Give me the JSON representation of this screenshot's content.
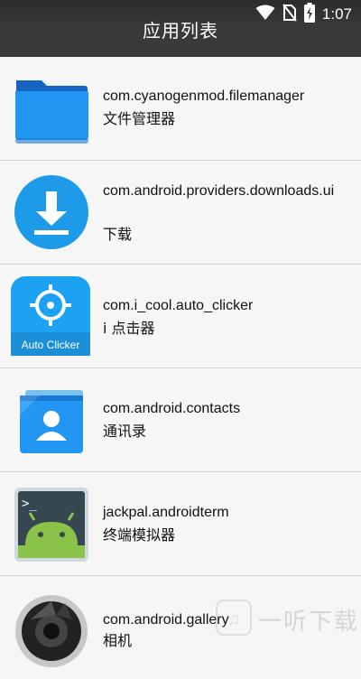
{
  "status_bar": {
    "time": "1:07",
    "icons": [
      "wifi-icon",
      "no-sim-icon",
      "battery-charging-icon"
    ]
  },
  "header": {
    "title": "应用列表"
  },
  "apps": [
    {
      "package": "com.cyanogenmod.filemanager",
      "label": "文件管理器",
      "icon": "folder-icon"
    },
    {
      "package": "com.android.providers.downloads.ui",
      "label": "下载",
      "icon": "download-icon"
    },
    {
      "package": "com.i_cool.auto_clicker",
      "label": "i 点击器",
      "icon": "auto-clicker-icon",
      "icon_text": "Auto Clicker"
    },
    {
      "package": "com.android.contacts",
      "label": "通讯录",
      "icon": "contacts-icon"
    },
    {
      "package": "jackpal.androidterm",
      "label": "终端模拟器",
      "icon": "terminal-icon",
      "icon_text": ">_"
    },
    {
      "package": "com.android.gallery",
      "label": "相机",
      "icon": "camera-icon"
    }
  ],
  "watermark": {
    "text": "一听下载"
  },
  "colors": {
    "header_bg": "#3a3a3a",
    "list_bg": "#f6f6f6",
    "divider": "#d6d6d6"
  }
}
